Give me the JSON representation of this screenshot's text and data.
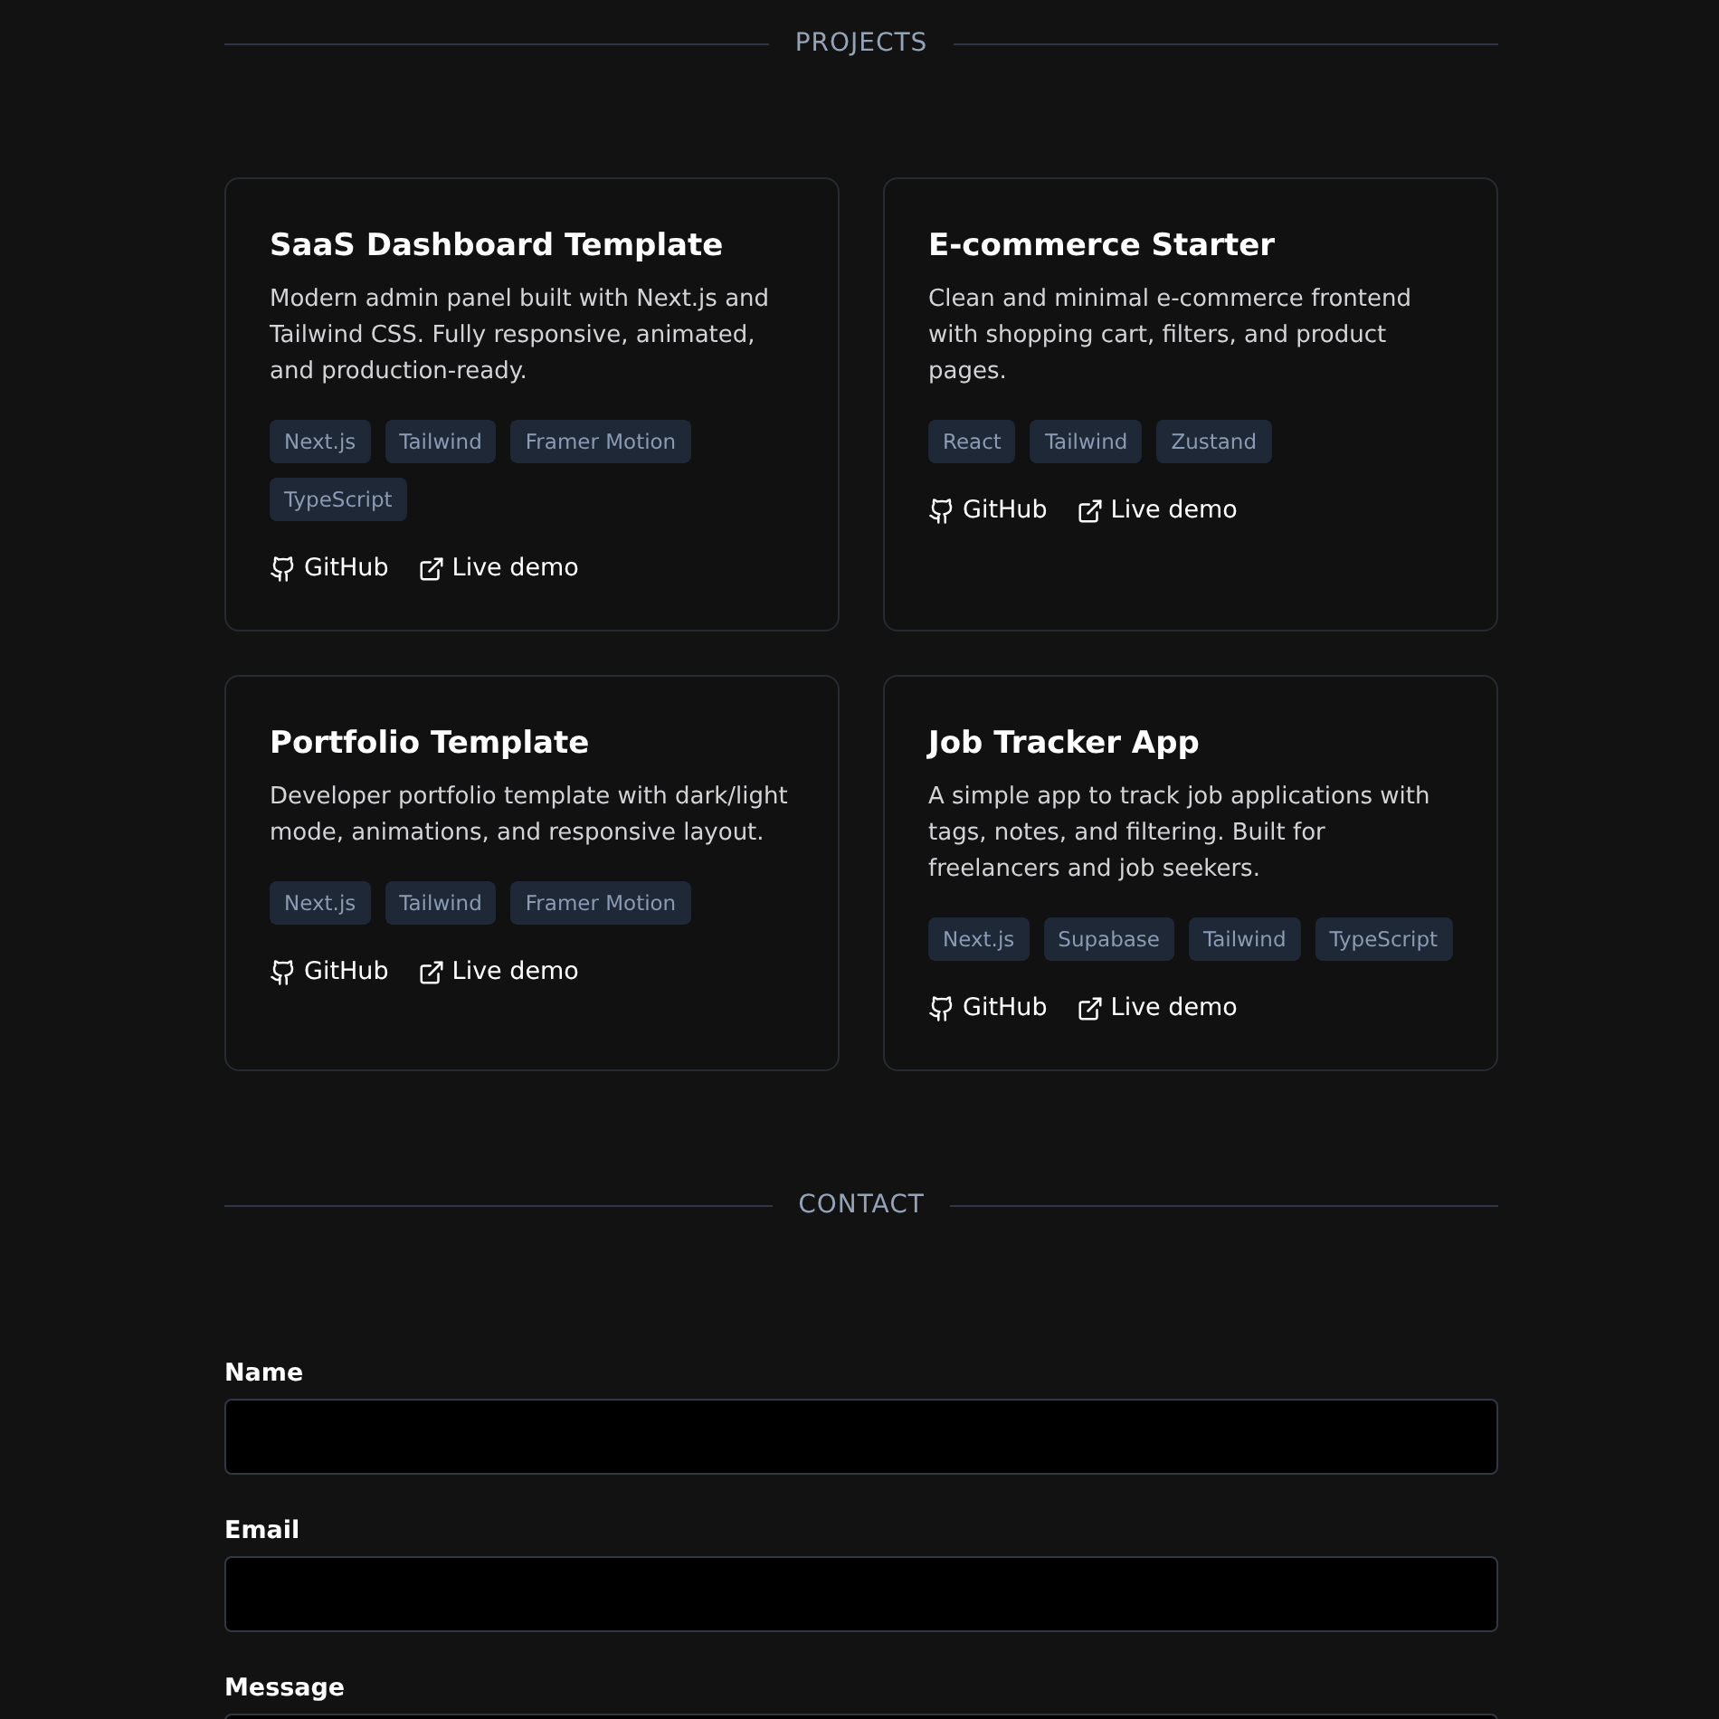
{
  "projects": {
    "heading": "PROJECTS",
    "cards": [
      {
        "title": "SaaS Dashboard Template",
        "description": "Modern admin panel built with Next.js and Tailwind CSS. Fully responsive, animated, and production-ready.",
        "tags": [
          "Next.js",
          "Tailwind",
          "Framer Motion",
          "TypeScript"
        ],
        "links": [
          {
            "kind": "github",
            "label": "GitHub"
          },
          {
            "kind": "external",
            "label": "Live demo"
          }
        ]
      },
      {
        "title": "E-commerce Starter",
        "description": "Clean and minimal e-commerce frontend with shopping cart, filters, and product pages.",
        "tags": [
          "React",
          "Tailwind",
          "Zustand"
        ],
        "links": [
          {
            "kind": "github",
            "label": "GitHub"
          },
          {
            "kind": "external",
            "label": "Live demo"
          }
        ]
      },
      {
        "title": "Portfolio Template",
        "description": "Developer portfolio template with dark/light mode, animations, and responsive layout.",
        "tags": [
          "Next.js",
          "Tailwind",
          "Framer Motion"
        ],
        "links": [
          {
            "kind": "github",
            "label": "GitHub"
          },
          {
            "kind": "external",
            "label": "Live demo"
          }
        ]
      },
      {
        "title": "Job Tracker App",
        "description": "A simple app to track job applications with tags, notes, and filtering. Built for freelancers and job seekers.",
        "tags": [
          "Next.js",
          "Supabase",
          "Tailwind",
          "TypeScript"
        ],
        "links": [
          {
            "kind": "github",
            "label": "GitHub"
          },
          {
            "kind": "external",
            "label": "Live demo"
          }
        ]
      }
    ]
  },
  "contact": {
    "heading": "CONTACT",
    "fields": [
      {
        "kind": "input",
        "label": "Name"
      },
      {
        "kind": "input",
        "label": "Email"
      },
      {
        "kind": "textarea",
        "label": "Message"
      }
    ]
  }
}
